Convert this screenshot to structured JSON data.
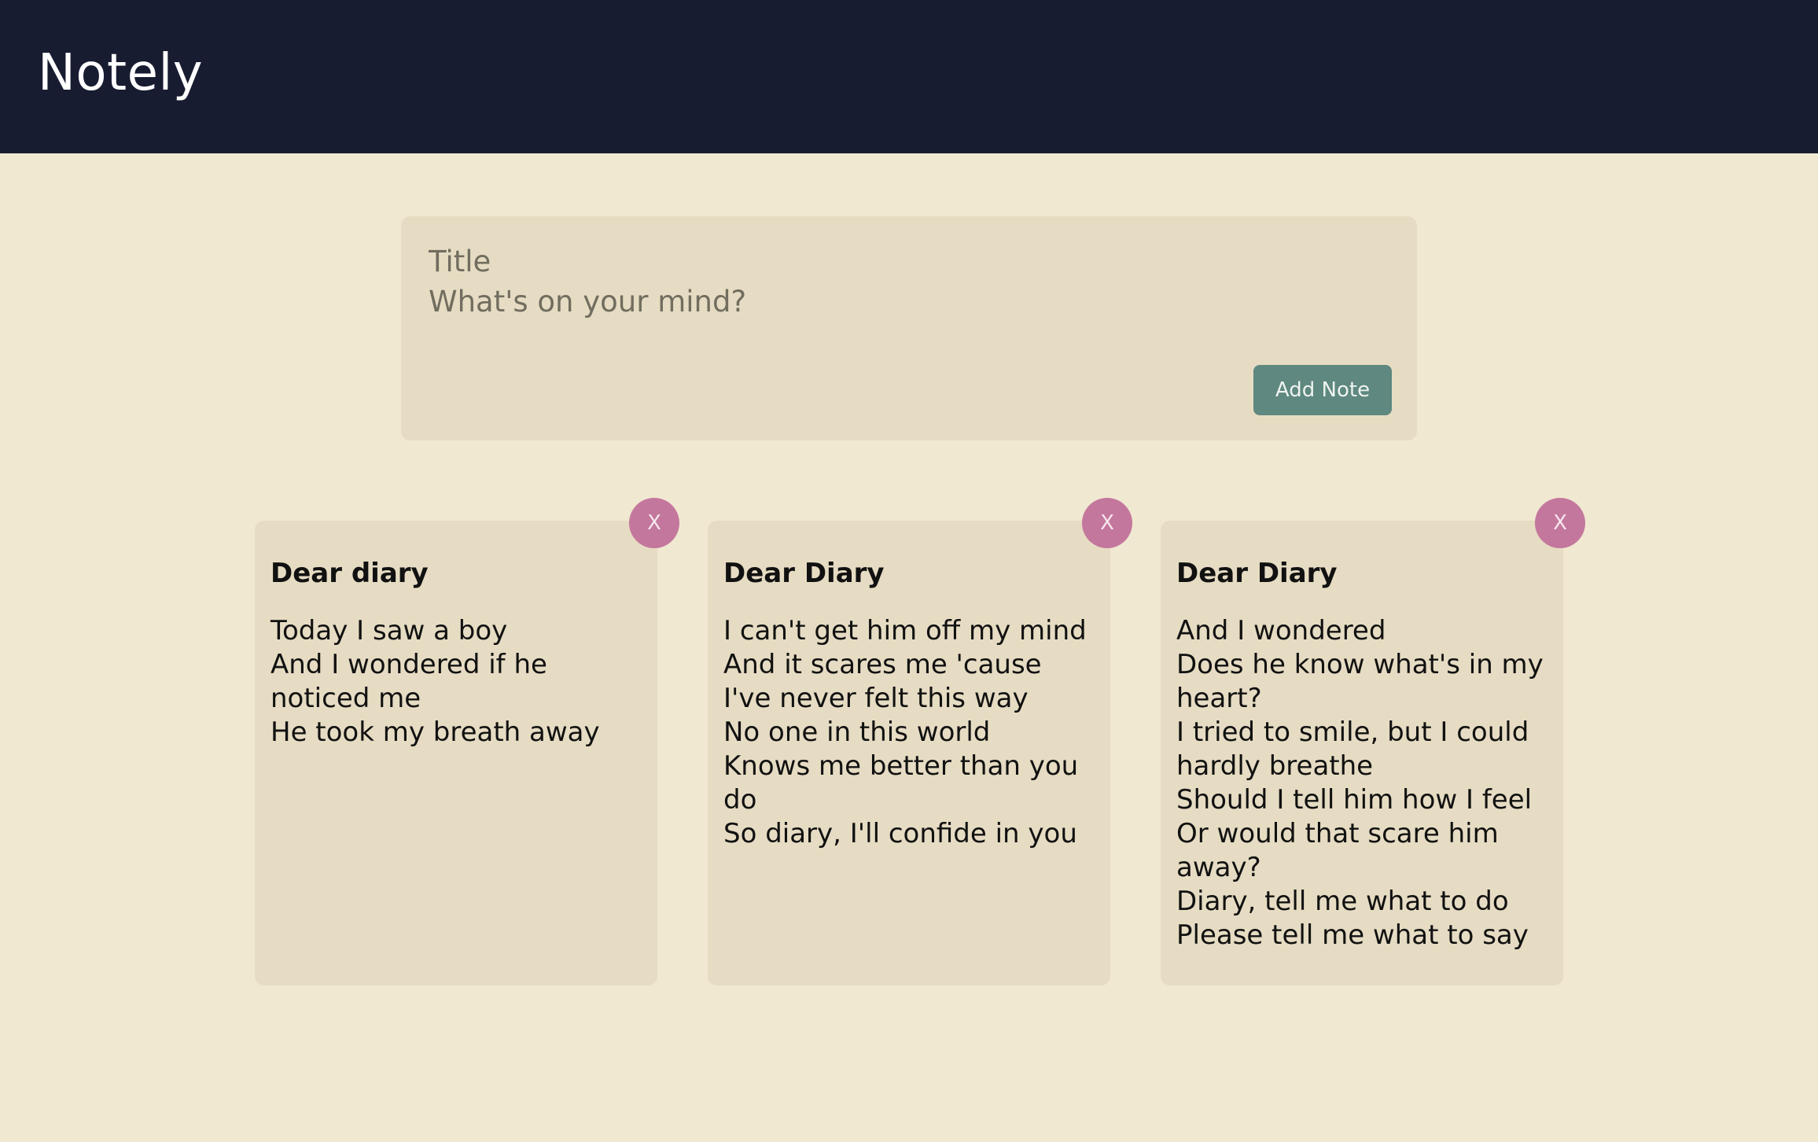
{
  "header": {
    "title": "Notely"
  },
  "composer": {
    "title_placeholder": "Title",
    "body_placeholder": "What's on your mind?",
    "add_label": "Add Note"
  },
  "notes": [
    {
      "title": "Dear diary",
      "body": "Today I saw a boy\nAnd I wondered if he noticed me\nHe took my breath away",
      "delete_label": "X"
    },
    {
      "title": "Dear Diary",
      "body": "I can't get him off my mind\nAnd it scares me 'cause I've never felt this way\nNo one in this world\nKnows me better than you do\nSo diary, I'll confide in you",
      "delete_label": "X"
    },
    {
      "title": "Dear Diary",
      "body": "And I wondered\nDoes he know what's in my heart?\nI tried to smile, but I could hardly breathe\nShould I tell him how I feel\nOr would that scare him away?\nDiary, tell me what to do\nPlease tell me what to say",
      "delete_label": "X"
    }
  ],
  "colors": {
    "header_bg": "#181c31",
    "page_bg": "#f0e8d1",
    "card_bg": "#e6dcc3",
    "add_button": "#5e8880",
    "delete_button": "#c4779c"
  }
}
